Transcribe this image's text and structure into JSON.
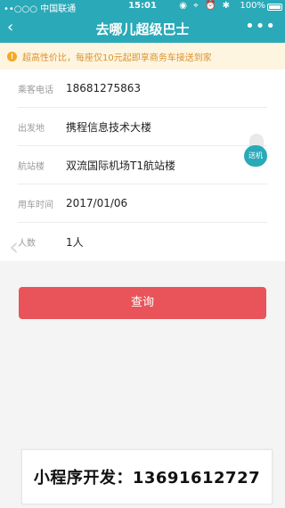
{
  "status_bar": {
    "carrier": "••○○○ 中国联通",
    "time": "15:01",
    "battery_percent": "100%",
    "icons": "◉ ⌖ ⏰ ✱"
  },
  "nav": {
    "back_icon": "‹",
    "title": "去哪儿超级巴士",
    "more_icon": "•••"
  },
  "notice": {
    "icon": "!",
    "text": "超高性价比，每座仅10元起即享商务车接送到家"
  },
  "form": {
    "rows": [
      {
        "label": "乘客电话",
        "value": "18681275863"
      },
      {
        "label": "出发地",
        "value": "携程信息技术大楼"
      },
      {
        "label": "航站楼",
        "value": "双流国际机场T1航站楼"
      },
      {
        "label": "用车时间",
        "value": "2017/01/06"
      },
      {
        "label": "人数",
        "value": "1人"
      }
    ]
  },
  "side_tab": {
    "label": "送机"
  },
  "query_button": {
    "label": "查询"
  },
  "contact": {
    "text": "小程序开发：13691612727"
  }
}
